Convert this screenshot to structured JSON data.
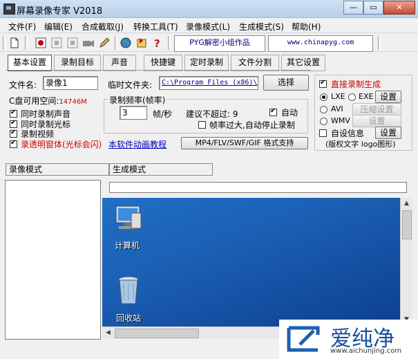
{
  "window": {
    "title": "屏幕录像专家 V2018",
    "minimize": "—",
    "maximize": "▭",
    "close": "✕"
  },
  "menu": [
    "文件(F)",
    "编辑(E)",
    "合成截取(J)",
    "转换工具(T)",
    "录像模式(L)",
    "生成模式(S)",
    "帮助(H)"
  ],
  "toolbar": {
    "banner_text": "PYG解密小组作品",
    "url_text": "www.chinapyg.com"
  },
  "tabs": [
    "基本设置",
    "录制目标",
    "声音",
    "快捷键",
    "定时录制",
    "文件分割",
    "其它设置"
  ],
  "basic": {
    "filename_label": "文件名:",
    "filename_value": "录像1",
    "tempdir_label": "临时文件夹:",
    "tempdir_value": "C:\\Program Files (x86)\\",
    "choose_button": "选择",
    "disk_space_label": "C盘可用空间:",
    "disk_space_value": "14746M",
    "checks": [
      {
        "label": "同时录制声音",
        "checked": true
      },
      {
        "label": "同时录制光标",
        "checked": true
      },
      {
        "label": "录制视频",
        "checked": true
      },
      {
        "label": "录透明窗体(光标会闪)",
        "checked": true
      }
    ],
    "animation_link": "本软件动画教程",
    "format_button": "MP4/FLV/SWF/GIF  格式支持"
  },
  "framerate": {
    "title": "录制频率(帧率)",
    "value": "3",
    "unit": "帧/秒",
    "suggest_label": "建议不超过: 9",
    "auto_label": "自动",
    "auto_checked": true,
    "stop_label": "帧率过大,自动停止录制",
    "stop_checked": false
  },
  "output": {
    "direct_label": "直接录制生成",
    "direct_checked": true,
    "lxe_label": "LXE",
    "exe_label": "EXE",
    "set_button": "设置",
    "avi_label": "AVI",
    "compress_button": "压缩设置",
    "wmv_label": "WMV",
    "wmv_set_button": "设置",
    "custom_label": "自设信息",
    "custom_set_button": "设置",
    "note": "(版权文字 logo图形)"
  },
  "lower": {
    "record_mode_tab": "录像模式",
    "generate_mode_tab": "生成模式",
    "icon_computer": "计算机",
    "icon_recycle": "回收站"
  },
  "watermark": {
    "text": "爱纯净",
    "url": "www.aichunjing.com"
  },
  "colors": {
    "accent_red": "#d00000",
    "desktop_blue": "#1b5fb3"
  }
}
